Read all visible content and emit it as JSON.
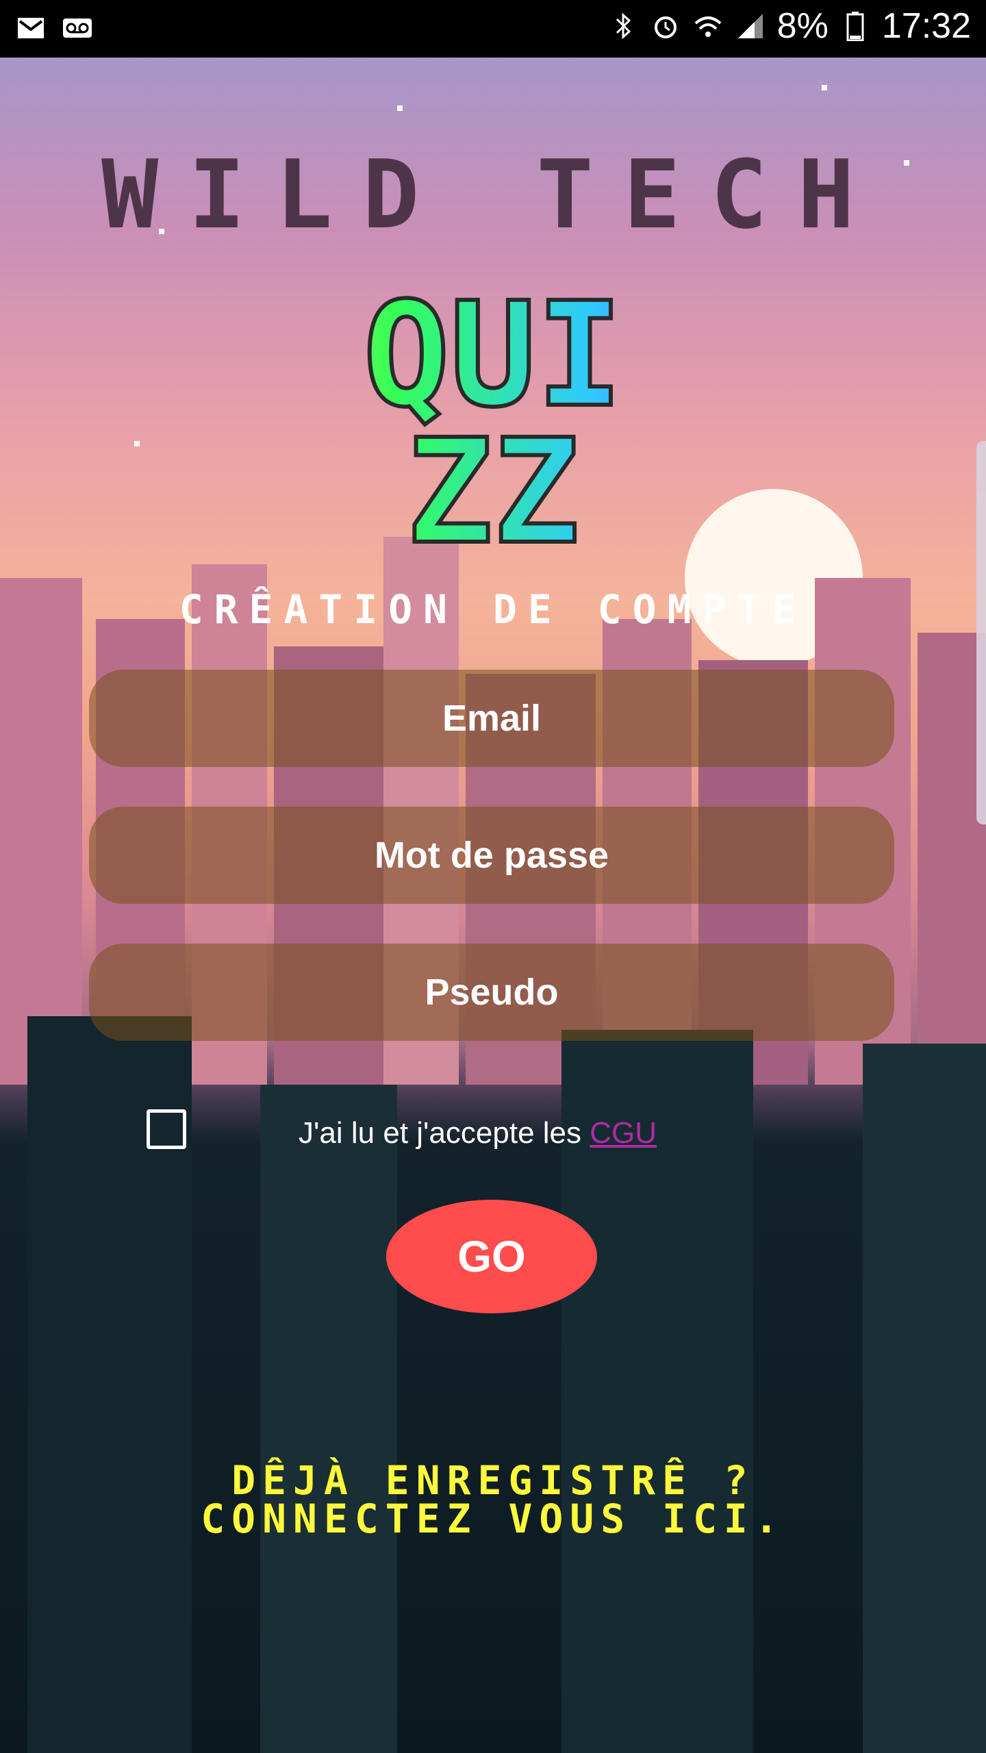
{
  "status_bar": {
    "battery": "8%",
    "time": "17:32",
    "icons": [
      "gmail-icon",
      "voicemail-icon",
      "bluetooth-icon",
      "alarm-icon",
      "wifi-icon",
      "signal-icon",
      "battery-icon"
    ]
  },
  "header": {
    "brand": "WILD TECH",
    "logo_line1": "QUI",
    "logo_line2": "ZZ",
    "subtitle": "CRÊATION DE COMPTE"
  },
  "form": {
    "email_placeholder": "Email",
    "password_placeholder": "Mot de passe",
    "pseudo_placeholder": "Pseudo",
    "terms_text": "J'ai lu et j'accepte les ",
    "terms_link": "CGU",
    "submit_label": "GO"
  },
  "footer": {
    "login_line1": "DÊJÀ ENREGISTRÊ ?",
    "login_line2": "CONNECTEZ VOUS ICI."
  },
  "colors": {
    "field_bg": "#7a5020",
    "go_button": "#ff4c4c",
    "login_link": "#fff93b",
    "cgu_link": "#b02aa5"
  }
}
